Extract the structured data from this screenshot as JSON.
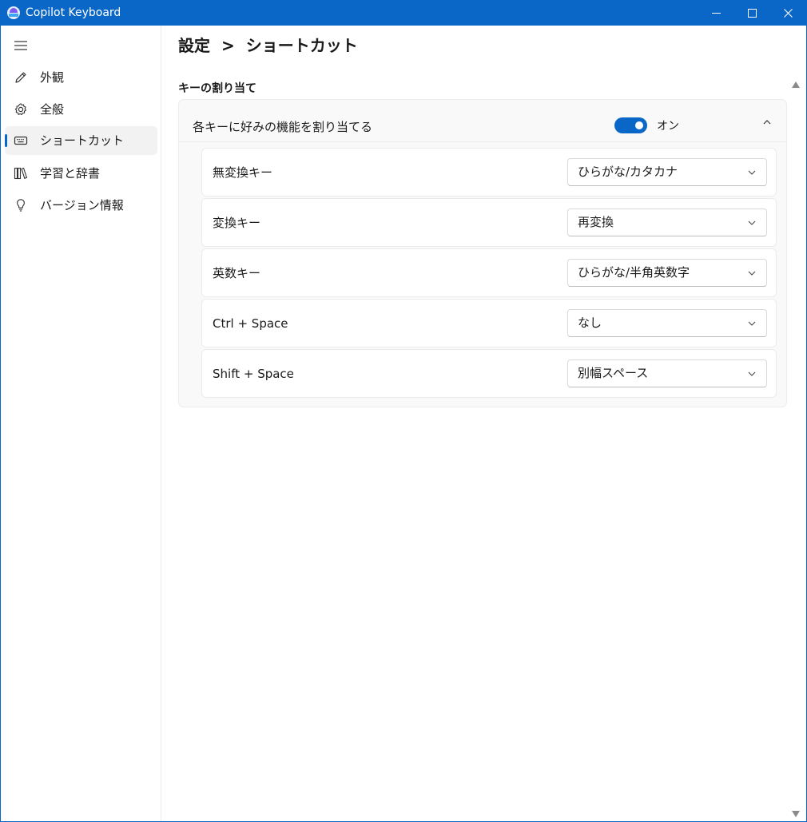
{
  "window": {
    "title": "Copilot Keyboard",
    "accent_color": "#0a67c7"
  },
  "titlebar": {
    "app_icon": "copilot-keyboard-logo",
    "minimize_icon": "minimize-icon",
    "maximize_icon": "maximize-icon",
    "close_icon": "close-icon"
  },
  "sidebar": {
    "menu_icon": "hamburger-icon",
    "items": [
      {
        "label": "外観",
        "icon": "pencil-icon",
        "selected": false
      },
      {
        "label": "全般",
        "icon": "gear-icon",
        "selected": false
      },
      {
        "label": "ショートカット",
        "icon": "keyboard-icon",
        "selected": true
      },
      {
        "label": "学習と辞書",
        "icon": "books-icon",
        "selected": false
      },
      {
        "label": "バージョン情報",
        "icon": "lightbulb-icon",
        "selected": false
      }
    ]
  },
  "main": {
    "breadcrumb": {
      "root": "設定",
      "separator": ">",
      "current": "ショートカット"
    },
    "section_title": "キーの割り当て",
    "card": {
      "header_label": "各キーに好みの機能を割り当てる",
      "toggle_on": true,
      "toggle_label": "オン",
      "expanded": true,
      "rows": [
        {
          "label": "無変換キー",
          "value": "ひらがな/カタカナ"
        },
        {
          "label": "変換キー",
          "value": "再変換"
        },
        {
          "label": "英数キー",
          "value": "ひらがな/半角英数字"
        },
        {
          "label": "Ctrl + Space",
          "value": "なし"
        },
        {
          "label": "Shift + Space",
          "value": "別幅スペース"
        }
      ]
    }
  }
}
